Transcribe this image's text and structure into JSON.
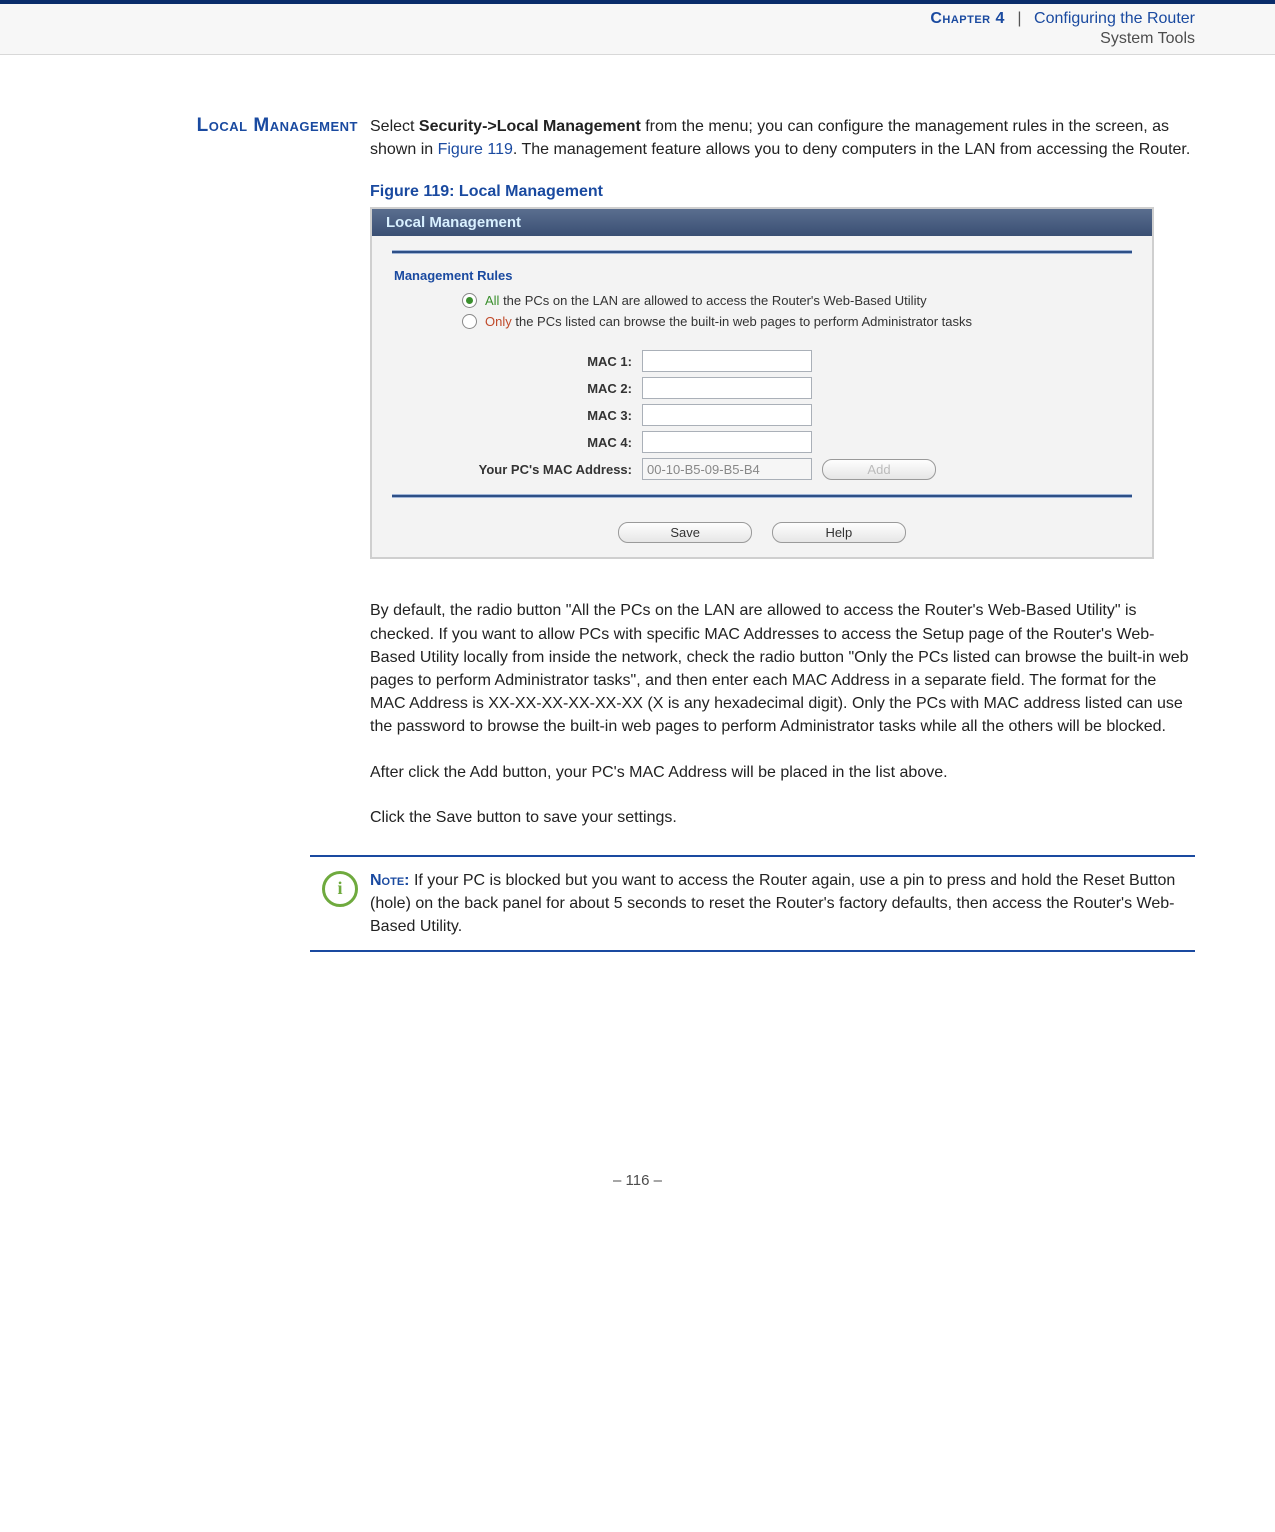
{
  "header": {
    "chapter_label": "Chapter 4",
    "chapter_title": "Configuring the Router",
    "subtitle": "System Tools"
  },
  "section": {
    "heading": "Local Management",
    "intro_prefix": "Select ",
    "intro_bold": "Security->Local Management",
    "intro_mid": " from the menu; you can configure the management rules in the screen, as shown in ",
    "intro_link": "Figure 119",
    "intro_suffix": ". The management feature allows you to deny computers in the LAN from accessing the Router."
  },
  "figure": {
    "caption": "Figure 119:  Local Management",
    "titlebar": "Local Management",
    "subhead": "Management Rules",
    "radio_all_first": "All",
    "radio_all_rest": " the PCs on the LAN are allowed to access the Router's Web-Based Utility",
    "radio_only_first": "Only",
    "radio_only_rest": " the PCs listed can browse the built-in web pages to perform Administrator tasks",
    "mac_labels": [
      "MAC 1:",
      "MAC 2:",
      "MAC 3:",
      "MAC 4:"
    ],
    "your_mac_label": "Your PC's MAC Address:",
    "your_mac_value": "00-10-B5-09-B5-B4",
    "add_btn": "Add",
    "save_btn": "Save",
    "help_btn": "Help"
  },
  "body": {
    "p1": "By default, the radio button \"All the PCs on the LAN are allowed to access the Router's Web-Based Utility\" is checked. If you want to allow PCs with specific MAC Addresses to access the Setup page of the Router's Web-Based Utility locally from inside the network, check the radio button \"Only the PCs listed can browse the built-in web pages to perform Administrator tasks\", and then enter each MAC Address in a separate field. The format for the MAC Address is XX-XX-XX-XX-XX-XX (X is any hexadecimal digit). Only the PCs with MAC address listed can use the password to browse the built-in web pages to perform Administrator tasks while all the others will be blocked.",
    "p2": "After click the Add button, your PC's MAC Address will be placed in the list above.",
    "p3": "Click the Save button to save your settings."
  },
  "note": {
    "icon": "i",
    "label": "Note:",
    "text": " If your PC is blocked but you want to access the Router again, use a pin to press and hold the Reset Button (hole) on the back panel for about 5 seconds to reset the Router's factory defaults, then access the Router's Web-Based Utility."
  },
  "footer": {
    "page": "–  116  –"
  }
}
